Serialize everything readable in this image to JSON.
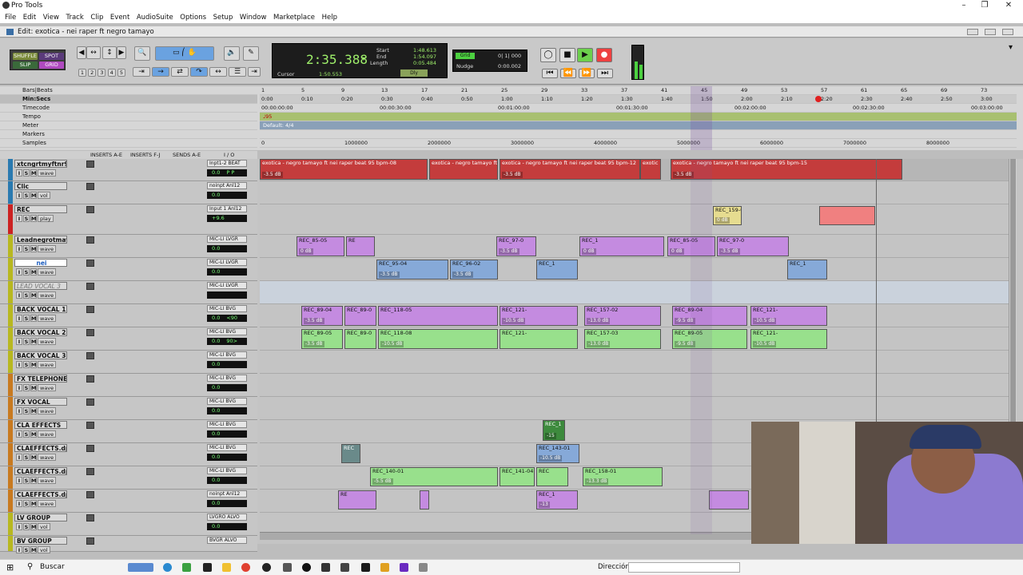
{
  "app": {
    "title": "Pro Tools"
  },
  "menu": [
    "File",
    "Edit",
    "View",
    "Track",
    "Clip",
    "Event",
    "AudioSuite",
    "Options",
    "Setup",
    "Window",
    "Marketplace",
    "Help"
  ],
  "edit_window": {
    "title": "Edit: exotica - nei raper ft negro tamayo"
  },
  "toolbar": {
    "modes": [
      "SHUFFLE",
      "SPOT",
      "SLIP",
      "GRID"
    ],
    "mode_active": "GRID",
    "counters": [
      "1",
      "2",
      "3",
      "4",
      "5"
    ],
    "main_counter": "2:35.388",
    "start_label": "Start",
    "start_value": "1:48.613",
    "end_label": "End",
    "end_value": "1:54.097",
    "length_label": "Length",
    "length_value": "0:05.484",
    "cursor_label": "Cursor",
    "cursor_value": "1:50.553",
    "dly_label": "Dly",
    "grid_label": "Grid",
    "grid_value": "0| 1| 000",
    "nudge_label": "Nudge",
    "nudge_value": "0:00.002"
  },
  "rulers": {
    "labels": [
      "Bars|Beats",
      "Min:Secs",
      "Timecode",
      "Tempo",
      "Meter",
      "Markers",
      "Samples"
    ],
    "bars": [
      "1",
      "5",
      "9",
      "13",
      "17",
      "21",
      "25",
      "29",
      "33",
      "37",
      "41",
      "45",
      "49",
      "53",
      "57",
      "61",
      "65",
      "69",
      "73"
    ],
    "minsecs": [
      "0:00",
      "0:10",
      "0:20",
      "0:30",
      "0:40",
      "0:50",
      "1:00",
      "1:10",
      "1:20",
      "1:30",
      "1:40",
      "1:50",
      "2:00",
      "2:10",
      "2:20",
      "2:30",
      "2:40",
      "2:50",
      "3:00"
    ],
    "timecode": [
      "00:00:00:00",
      "00:00:30:00",
      "00:01:00:00",
      "00:01:30:00",
      "00:02:00:00",
      "00:02:30:00",
      "00:03:00:00"
    ],
    "tempo": "♩95",
    "meter": "Default: 4/4",
    "samples": [
      "0",
      "1000000",
      "2000000",
      "3000000",
      "4000000",
      "5000000",
      "6000000",
      "7000000",
      "8000000"
    ]
  },
  "mix_header": {
    "inserts_ae": "INSERTS A-E",
    "inserts_fj": "INSERTS F-J",
    "sends_ae": "SENDS A-E",
    "io": "I / O"
  },
  "tracks": [
    {
      "name": "xtcngrtmyftnr95",
      "type": "wave",
      "io": "Inpt1-2",
      "out": "BEAT",
      "vol": "0.0",
      "pan": "P P",
      "color": "#2a7ab0"
    },
    {
      "name": "Clic",
      "type": "vol",
      "io": "noinpt",
      "out": "Anl12",
      "vol": "0.0",
      "pan": "",
      "color": "#2a7ab0"
    },
    {
      "name": "REC",
      "type": "play",
      "io": "Input 1",
      "out": "Anl12",
      "vol": "+9.6",
      "pan": "",
      "color": "#c22"
    },
    {
      "name": "Leadnegrotmay",
      "type": "wave",
      "io": "MIC-LI",
      "out": "LVGR",
      "vol": "0.0",
      "pan": "",
      "color": "#b8b820"
    },
    {
      "name": "nei",
      "type": "wave",
      "io": "MIC-LI",
      "out": "LVGR",
      "vol": "0.0",
      "pan": "",
      "color": "#b8b820"
    },
    {
      "name": "LEAD VOCAL 3",
      "type": "wave",
      "io": "MIC-LI",
      "out": "LVGR",
      "vol": "",
      "pan": "",
      "color": "#b8b820"
    },
    {
      "name": "BACK VOCAL 1",
      "type": "wave",
      "io": "MIC-LI",
      "out": "BVG",
      "vol": "0.0",
      "pan": "<90",
      "color": "#b8b820"
    },
    {
      "name": "BACK VOCAL 2",
      "type": "wave",
      "io": "MIC-LI",
      "out": "BVG",
      "vol": "0.0",
      "pan": "90>",
      "color": "#b8b820"
    },
    {
      "name": "BACK VOCAL 3",
      "type": "wave",
      "io": "MIC-LI",
      "out": "BVG",
      "vol": "0.0",
      "pan": "",
      "color": "#b8b820"
    },
    {
      "name": "FX TELEPHONE",
      "type": "wave",
      "io": "MIC-LI",
      "out": "BVG",
      "vol": "0.0",
      "pan": "",
      "color": "#c87a20"
    },
    {
      "name": "FX VOCAL",
      "type": "wave",
      "io": "MIC-LI",
      "out": "BVG",
      "vol": "0.0",
      "pan": "",
      "color": "#c87a20"
    },
    {
      "name": "CLA EFFECTS",
      "type": "wave",
      "io": "MIC-LI",
      "out": "BVG",
      "vol": "0.0",
      "pan": "",
      "color": "#c87a20"
    },
    {
      "name": "CLAEFFECTS.dp1",
      "type": "wave",
      "io": "MIC-LI",
      "out": "BVG",
      "vol": "0.0",
      "pan": "",
      "color": "#c87a20"
    },
    {
      "name": "CLAEFFECTS.dp2",
      "type": "wave",
      "io": "MIC-LI",
      "out": "BVG",
      "vol": "0.0",
      "pan": "",
      "color": "#c87a20"
    },
    {
      "name": "CLAEFFECTS.dp3",
      "type": "wave",
      "io": "noinpt",
      "out": "Anl12",
      "vol": "0.0",
      "pan": "",
      "color": "#c87a20"
    },
    {
      "name": "LV GROUP",
      "type": "vol",
      "io": "LVGRO",
      "out": "ALVO",
      "vol": "0.0",
      "pan": "",
      "color": "#b8b820"
    },
    {
      "name": "BV GROUP",
      "type": "vol",
      "io": "BVGR",
      "out": "ALVO",
      "vol": "",
      "pan": "",
      "color": "#b8b820"
    }
  ],
  "clips": {
    "beat": [
      "exotica - negro tamayo ft nei raper beat 95 bpm-08",
      "exotica - negro tamayo ft",
      "exotica - negro tamayo ft nei raper beat 95 bpm-12",
      "exotic",
      "exotica - negro tamayo ft nei raper beat 95 bpm-15"
    ],
    "beat_gain": "-3.5 dB",
    "rec": "REC_159-(",
    "rec_gain": "0 dB",
    "lead": [
      "REC_85-05",
      "RE",
      "RE",
      "REC_97-0",
      "RE",
      "REC_1",
      "REC_1",
      "REC_1",
      "RE",
      "REC_85-05",
      "RE",
      "REC_97-0",
      "RE"
    ],
    "lead_gain": [
      "0 dB",
      "-3.5 dB"
    ],
    "nei": [
      "REC_95-04",
      "REC_96-02",
      "REC_1",
      "REC_1",
      "RE"
    ],
    "nei_gain": "-3.5 dB",
    "bv1": [
      "REC_89-04",
      "REC_89-0",
      "REC_118-05",
      "REC_1",
      "RE",
      "REC_121-",
      "REC_154",
      "REC_157-02",
      "REC_89-04",
      "REC_89-0",
      "REC_1",
      "RE",
      "RE",
      "REC_121-"
    ],
    "bv2": [
      "REC_89-05",
      "REC_89-0",
      "REC_118-08",
      "REC_1",
      "RE",
      "REC_121-",
      "REC_154",
      "REC_157-03",
      "REC_89-05",
      "REC_89-0",
      "REC_1",
      "RE",
      "RE",
      "REC_121-"
    ],
    "bv_gains": [
      "-3.5 dB",
      "-10.5 dB",
      "-13.0 dB",
      "-9.5 dB",
      "-10.5 dB"
    ],
    "cla": "REC_1",
    "cla_gain": "-15",
    "dp1": [
      "REC",
      "REC_143-01"
    ],
    "dp1_gain": "-10.5 dB",
    "dp2": [
      "REC_140-01",
      "REC_141-04",
      "REC",
      "REC_158-01"
    ],
    "dp2_gain": [
      "-5.5 dB",
      "-13.3 dB"
    ],
    "dp3": [
      "RE",
      "RE",
      "REC_1",
      "-13"
    ]
  },
  "taskbar": {
    "search": "Buscar",
    "address_label": "Dirección"
  },
  "colors": {
    "beat": "#c43c3c",
    "lead": "#c48be0",
    "nei": "#86a9d8",
    "bv2": "#98e08c",
    "rec": "#e6dc90",
    "counter": "#9ff06b"
  }
}
